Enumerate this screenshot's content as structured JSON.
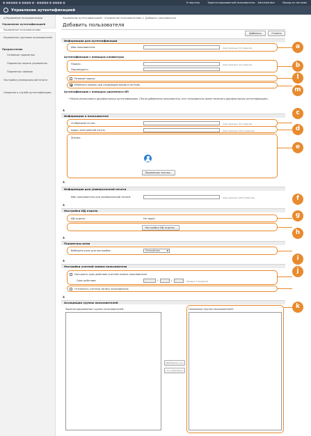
{
  "topbar": {
    "left_text": "■ ■■■■■ ■ ■■■■ ■ / ■■■■■ ■ ■■■■ ■",
    "portal_link": "К порталу",
    "registered_user": "Зарегистрированный пользователь:",
    "username": "Administrator",
    "logout": "Выход из системы"
  },
  "app": {
    "title": "Управление аутентификацией"
  },
  "sidebar": {
    "back": "◂ Управление пользователями",
    "head1": "Управление аутентификацией",
    "users": "Управление пользователями",
    "groups": "Управление группами пользователей",
    "head2": "Предпочтения",
    "basic": "Основные параметры",
    "login_screen": "Параметры экрана управления",
    "server": "Параметры сервера",
    "universal": "Настройки универсальной печати",
    "service_info": "Сведения о службе аутентификации"
  },
  "breadcrumb": "Управление аутентификацией : Управление пользователями > Добавить пользователя",
  "page_title": "Добавить пользователя",
  "buttons": {
    "add": "Добавить",
    "cancel": "Отмена"
  },
  "auth": {
    "section": "Информация для аутентификации",
    "username_label": "Имя пользователя:",
    "username_hint": "(максимально 32 символа)",
    "keyboard_head": "Аутентификация с помощью клавиатуры",
    "password_label": "Пароль:",
    "password_hint": "(максимально 32 символа)",
    "confirm_label": "Подтвердить:",
    "onetime_label": "Разовый пароль",
    "change_pw_label": "Изменить пароль при следующем входе в систему",
    "mobile_head": "Аутентификация с помощью удаленного ИП",
    "mobile_note": "• Можно использовать двухфакторную аутентификацию. (После добавления пользователя, этот пользователь может включить двухфакторную аутентификацию..."
  },
  "user_info": {
    "section": "Информация о пользователе",
    "display_label": "Отображается как:",
    "display_hint": "(максимально 32 символа)",
    "email_label": "Адрес электронной почты:",
    "email_hint": "(максимально 256 символов)",
    "icon_label": "Значок:",
    "icon_button": "Параметры значка..."
  },
  "universal_print": {
    "section": "Информация для универсальной печати",
    "username_label": "Имя пользователя для универсальной печати:",
    "username_hint": "(максимально 256 символов)"
  },
  "dept_id": {
    "section": "Настройки ИД отдела",
    "label": "ИД отдела:",
    "value": "Не задан",
    "button": "Настройки ИД отдела..."
  },
  "role": {
    "section": "Параметры роли",
    "label": "Выберите роль для настройки:",
    "selected": "GeneralUser"
  },
  "account": {
    "section": "Настройки учетной записи пользователя",
    "expiry_label": "Настроить срок действия учетной записи пользователя",
    "term_label": "Срок действия:",
    "date_hint": "(ммдд в стандарте)",
    "disable_label": "Отключить учетную запись пользователя"
  },
  "groups": {
    "section": "Ассоциация группы пользователей",
    "registered_label": "Зарегистрированные группы пользователей:",
    "assigned_label": "Связанные группы пользователей:",
    "add_btn": "Добавить >>",
    "remove_btn": "<< Удалить"
  },
  "callouts": [
    "a",
    "b",
    "l",
    "m",
    "c",
    "d",
    "e",
    "f",
    "g",
    "h",
    "i",
    "j",
    "k"
  ],
  "colors": {
    "callout": "#e88a2e",
    "appbar": "#3b4a5c",
    "avatar": "#2a7fd4"
  }
}
